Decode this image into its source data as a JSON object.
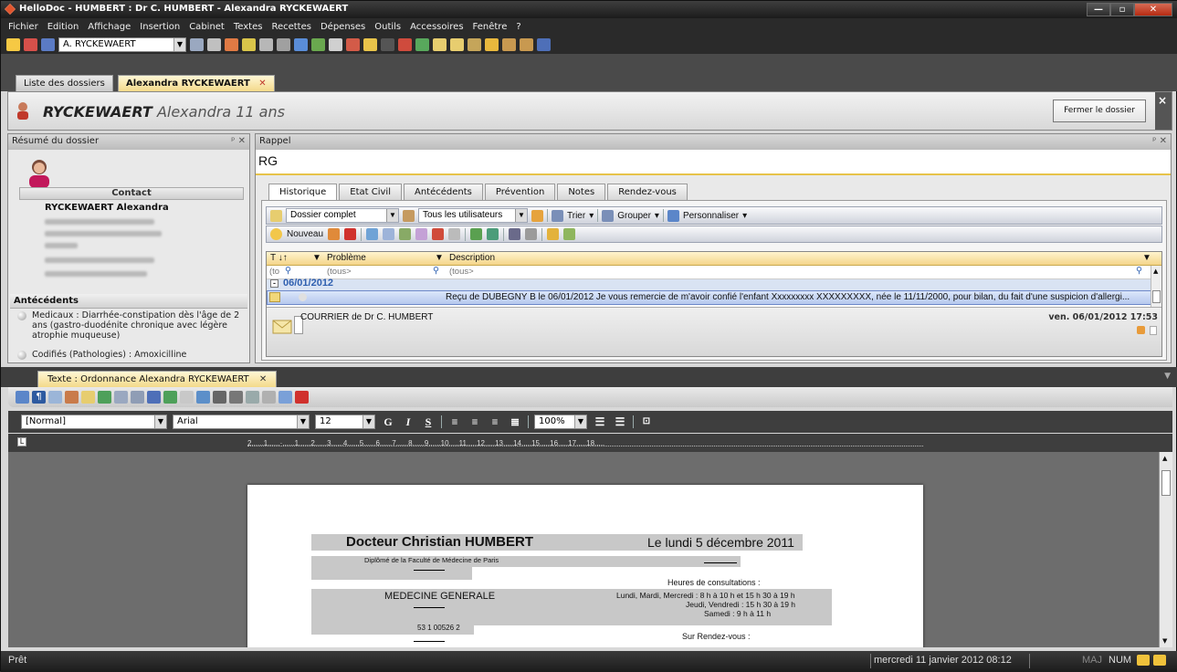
{
  "window": {
    "title": "HelloDoc - HUMBERT : Dr C. HUMBERT - Alexandra RYCKEWAERT",
    "minimize_label": "—",
    "maximize_label": "▫",
    "close_label": "✕"
  },
  "menu": {
    "items": [
      "Fichier",
      "Edition",
      "Affichage",
      "Insertion",
      "Cabinet",
      "Textes",
      "Recettes",
      "Dépenses",
      "Outils",
      "Accessoires",
      "Fenêtre",
      "?"
    ]
  },
  "toolbar": {
    "patient_combo_value": "A. RYCKEWAERT"
  },
  "doc_tabs": {
    "list_label": "Liste des dossiers",
    "active_label": "Alexandra RYCKEWAERT",
    "close_glyph": "✕"
  },
  "patient": {
    "last_name": "RYCKEWAERT",
    "first_name_age": "Alexandra 11 ans",
    "close_button": "Fermer le dossier",
    "close_glyph": "×"
  },
  "summary": {
    "title": "Résumé du dossier",
    "pin_glyph": "ᵖ ✕",
    "contact_header": "Contact",
    "contact_name": "RYCKEWAERT Alexandra",
    "antecedents_header": "Antécédents",
    "antecedents": [
      "Medicaux : Diarrhée-constipation dès l'âge de 2 ans (gastro-duodénite chronique avec légère atrophie muqueuse)",
      "Codifiés (Pathologies) : Amoxicilline"
    ]
  },
  "rappel": {
    "title": "Rappel",
    "pin_glyph": "ᵖ ✕",
    "text": "RG"
  },
  "tabs": [
    "Historique",
    "Etat Civil",
    "Antécédents",
    "Prévention",
    "Notes",
    "Rendez-vous"
  ],
  "history": {
    "filter_dossier": "Dossier complet",
    "filter_users": "Tous les utilisateurs",
    "trier": "Trier",
    "grouper": "Grouper",
    "personnaliser": "Personnaliser",
    "nouveau": "Nouveau",
    "col_t": "T",
    "col_problem": "Problème",
    "col_description": "Description",
    "filter_t": "(to",
    "filter_problem": "(tous>",
    "filter_description": "(tous>",
    "group_date": "06/01/2012",
    "row_text": "Reçu de  DUBEGNY B le 06/01/2012   Je vous remercie de m'avoir confié l'enfant Xxxxxxxxx XXXXXXXXX, née le 11/11/2000, pour bilan, du fait d'une suspicion d'allergi...",
    "preview_title": "COURRIER de Dr C. HUMBERT",
    "preview_date": "ven. 06/01/2012 17:53"
  },
  "editor": {
    "tab_label": "Texte : Ordonnance Alexandra RYCKEWAERT",
    "style_value": "[Normal]",
    "font_value": "Arial",
    "size_value": "12",
    "zoom_value": "100%",
    "ruler_text": "2......1......·......1......2......3......4......5......6......7......8......9......10.....11.....12.....13.....14.....15.....16.....17.....18.....",
    "doc": {
      "doctor": "Docteur Christian HUMBERT",
      "date": "Le lundi 5 décembre 2011",
      "diploma": "Diplômé de la Faculté de Médecine de Paris",
      "heures_title": "Heures de consultations :",
      "specialty": "MEDECINE GENERALE",
      "hours1": "Lundi, Mardi, Mercredi : 8 h à 10 h  et  15 h 30 à 19 h",
      "hours2": "Jeudi, Vendredi : 15 h 30 à 19 h",
      "hours3": "Samedi : 9 h à 11 h",
      "number": "53 1 00526 2",
      "rdv": "Sur Rendez-vous :"
    }
  },
  "status": {
    "left": "Prêt",
    "datetime": "mercredi 11 janvier 2012 08:12",
    "maj": "MAJ",
    "num": "NUM"
  },
  "colors": {
    "accent_gold": "#f3d98a",
    "title_bar": "#2a2a2a",
    "selection_blue": "#b6c9ee"
  }
}
